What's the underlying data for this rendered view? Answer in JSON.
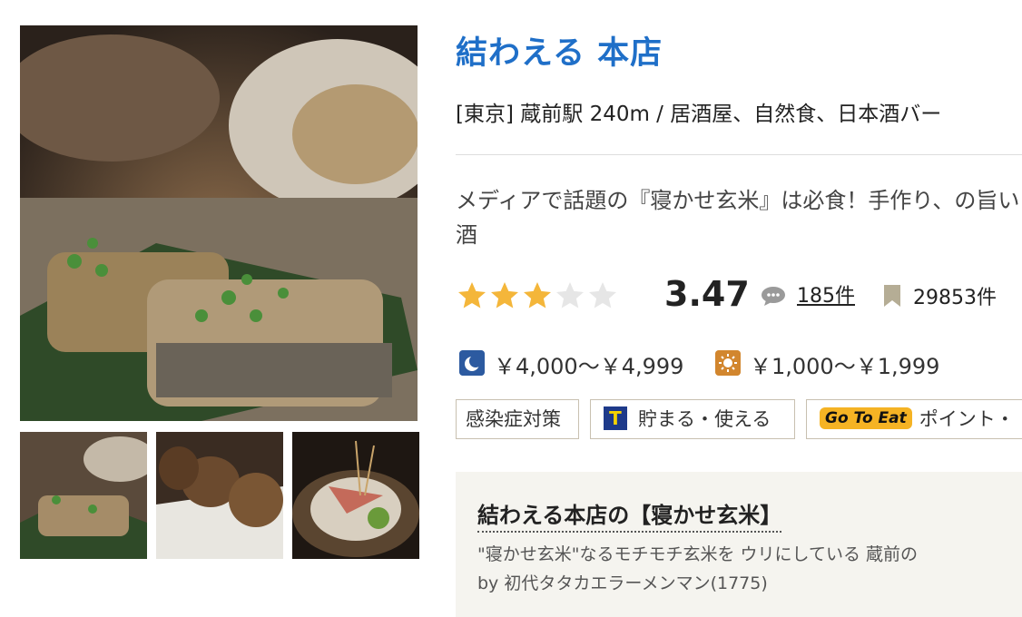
{
  "restaurant": {
    "name": "結わえる 本店",
    "meta": "[東京] 蔵前駅 240m / 居酒屋、自然食、日本酒バー",
    "catch": "メディアで話題の『寝かせ玄米』は必食！手作り、の旨い酒",
    "rating": 3.47,
    "rating_label": "3.47",
    "review_count": "185件",
    "bookmark_count": "29853件",
    "price_dinner": "￥4,000～￥4,999",
    "price_lunch": "￥1,000～￥1,999"
  },
  "badges": {
    "infection": "感染症対策",
    "tpoint": "貯まる・使える",
    "goto_logo": "Go To Eat",
    "goto_text": "ポイント・"
  },
  "review": {
    "title": "結わえる本店の【寝かせ玄米】",
    "snippet": "\"寝かせ玄米\"なるモチモチ玄米を ウリにしている 蔵前の",
    "author": "by 初代タタカエラーメンマン(1775)"
  },
  "colors": {
    "title": "#1f6fc8",
    "star_on": "#f4b63a",
    "star_off": "#e6e6e6"
  }
}
